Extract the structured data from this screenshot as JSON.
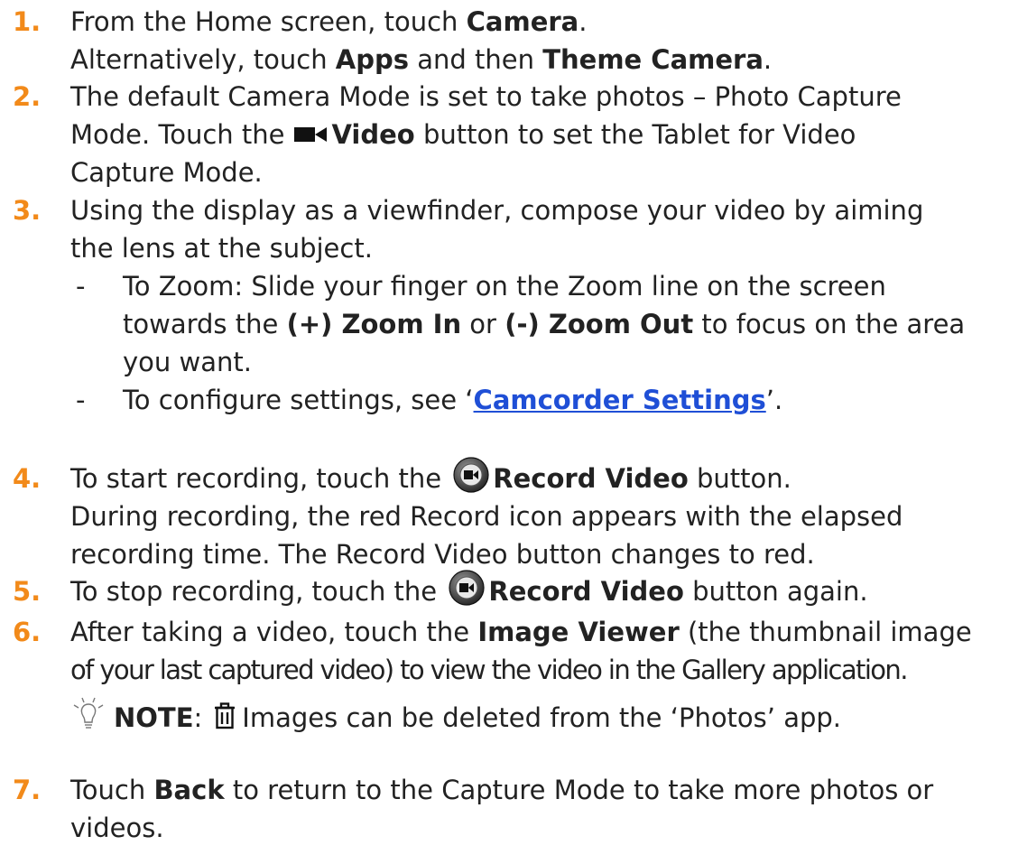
{
  "accent_color": "#f28a1a",
  "link_color": "#1f4fd6",
  "steps": [
    {
      "num": "1.",
      "l1_a": "From the Home screen, touch ",
      "l1_b": "Camera",
      "l1_c": ".",
      "l2_a": "Alternatively, touch ",
      "l2_b": "Apps",
      "l2_c": " and then ",
      "l2_d": "Theme Camera",
      "l2_e": "."
    },
    {
      "num": "2.",
      "l1": "The default Camera Mode is set to take photos – Photo Capture",
      "l2_a": "Mode. Touch the",
      "l2_icon": "video-camera-icon",
      "l2_b": "Video",
      "l2_c": " button to set the Tablet for Video",
      "l3": "Capture Mode."
    },
    {
      "num": "3.",
      "l1": "Using the display as a viewfinder, compose your video by aiming",
      "l2": "the lens at the subject.",
      "b1_dash": "-",
      "b1_l1": "To Zoom: Slide your finger on the Zoom line on the screen",
      "b1_l2_a": "towards the ",
      "b1_l2_b": "(+) Zoom In",
      "b1_l2_c": " or ",
      "b1_l2_d": "(-) Zoom Out",
      "b1_l2_e": " to focus on the area",
      "b1_l3": "you want.",
      "b2_dash": "-",
      "b2_a": "To configure settings, see ‘",
      "b2_link": "Camcorder Settings",
      "b2_c": "’."
    },
    {
      "num": "4.",
      "l1_a": "To start recording, touch the ",
      "l1_icon": "record-video-icon",
      "l1_b": "Record Video",
      "l1_c": " button.",
      "l2": "During recording, the red Record icon appears with the elapsed",
      "l3": "recording time. The Record Video button changes to red."
    },
    {
      "num": "5.",
      "l1_a": "To stop recording, touch the ",
      "l1_icon": "record-video-icon",
      "l1_b": "Record Video",
      "l1_c": " button again."
    },
    {
      "num": "6.",
      "l1_a": "After taking a video, touch the ",
      "l1_b": "Image Viewer",
      "l1_c": " (the thumbnail image",
      "l2": "of your last captured video) to view the video in the Gallery application.",
      "note_label": "NOTE",
      "note_colon": ":",
      "note_text": "Images can be deleted from the ‘Photos’ app."
    },
    {
      "num": "7.",
      "l1_a": "Touch ",
      "l1_b": "Back",
      "l1_c": " to return to the Capture Mode to take more photos or",
      "l2": "videos."
    }
  ]
}
